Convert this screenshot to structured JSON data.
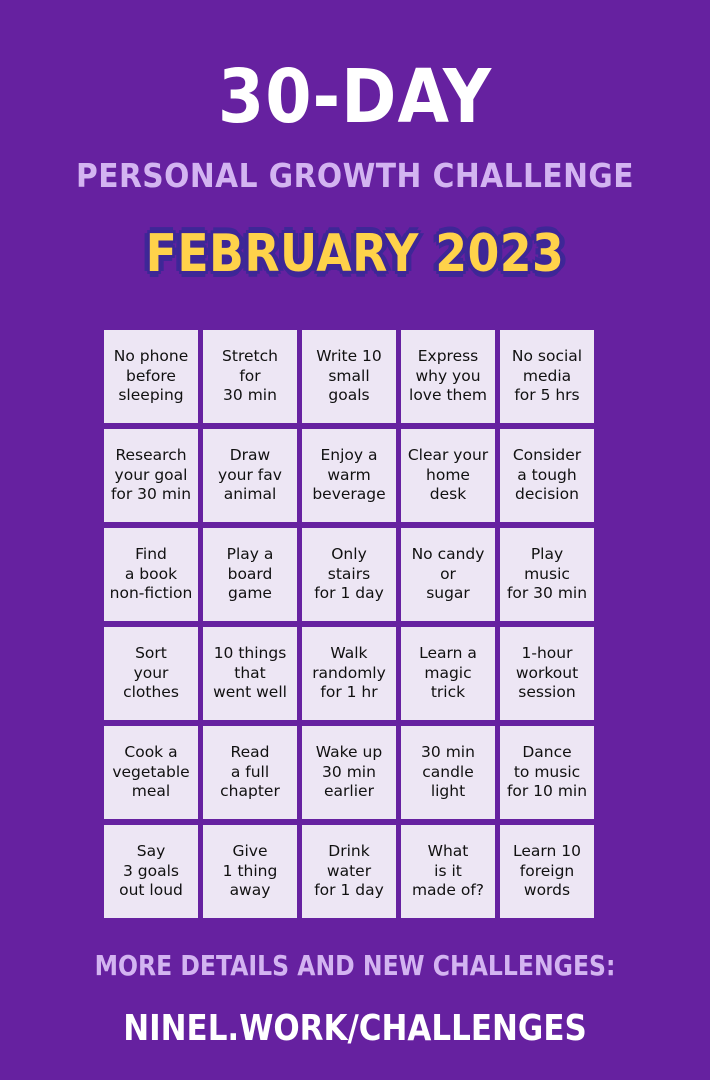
{
  "header": {
    "title": "30-DAY",
    "subtitle": "PERSONAL GROWTH CHALLENGE",
    "month": "FEBRUARY 2023"
  },
  "colors": {
    "background": "#6621a0",
    "title": "#ffffff",
    "subtitle": "#d3b4f1",
    "month": "#ffd24a",
    "month_outline": "#3e2797",
    "cell": "#ede6f4"
  },
  "challenges": [
    "No phone\nbefore\nsleeping",
    "Stretch\nfor\n30 min",
    "Write 10\nsmall\ngoals",
    "Express\nwhy you\nlove them",
    "No social\nmedia\nfor 5 hrs",
    "Research\nyour goal\nfor 30 min",
    "Draw\nyour fav\nanimal",
    "Enjoy a\nwarm\nbeverage",
    "Clear your\nhome\ndesk",
    "Consider\na tough\ndecision",
    "Find\na book\nnon-fiction",
    "Play a\nboard\ngame",
    "Only\nstairs\nfor 1 day",
    "No candy\nor\nsugar",
    "Play\nmusic\nfor 30 min",
    "Sort\nyour\nclothes",
    "10 things\nthat\nwent well",
    "Walk\nrandomly\nfor 1 hr",
    "Learn a\nmagic\ntrick",
    "1-hour\nworkout\nsession",
    "Cook a\nvegetable\nmeal",
    "Read\na full\nchapter",
    "Wake up\n30 min\nearlier",
    "30 min\ncandle\nlight",
    "Dance\nto music\nfor 10 min",
    "Say\n3 goals\nout loud",
    "Give\n1 thing\naway",
    "Drink\nwater\nfor 1 day",
    "What\nis it\nmade of?",
    "Learn 10\nforeign\nwords"
  ],
  "footer": {
    "details": "MORE DETAILS AND NEW CHALLENGES:",
    "link": "NINEL.WORK/CHALLENGES"
  }
}
